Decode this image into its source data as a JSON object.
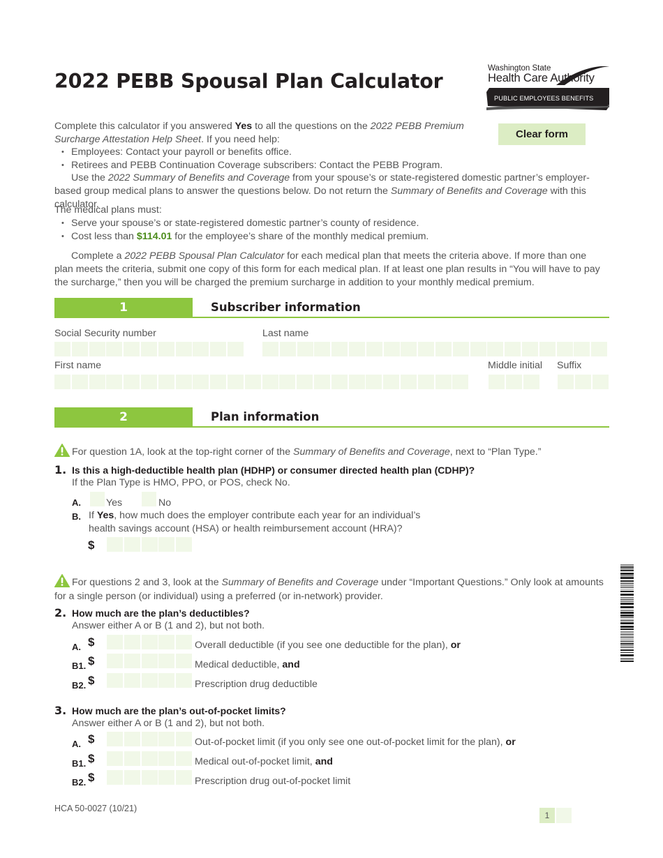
{
  "header": {
    "title": "2022 PEBB Spousal Plan Calculator",
    "logo": {
      "line1": "Washington State",
      "line2": "Health Care Authority",
      "band": "PUBLIC EMPLOYEES BENEFITS BOARD"
    },
    "clear_button": "Clear form"
  },
  "intro": {
    "p1_a": "Complete this calculator if you answered ",
    "p1_yes": "Yes",
    "p1_b": " to all the questions on the ",
    "p1_doc": "2022 PEBB Premium Surcharge Attestation Help Sheet",
    "p1_c": ". If you need help:",
    "help_items": [
      "Employees: Contact your payroll or benefits office.",
      "Retirees and PEBB Continuation Coverage subscribers: Contact the PEBB Program."
    ],
    "p2_a": "Use the ",
    "p2_doc": "2022 Summary of Benefits and Coverage",
    "p2_b": " from your spouse’s or state-registered domestic partner’s employer-based group medical plans to answer the questions below. Do not return the ",
    "p2_doc2": "Summary of Benefits and Coverage",
    "p2_c": " with this calculator.",
    "must_label": "The medical plans must:",
    "must_item1": "Serve your spouse’s or state-registered domestic partner’s county of residence.",
    "must_item2_a": "Cost less than ",
    "must_item2_amount": "$114.01",
    "must_item2_b": " for the employee’s share of the monthly medical premium.",
    "p3_a": "Complete a ",
    "p3_doc": "2022 PEBB Spousal Plan Calculator",
    "p3_b": " for each medical plan that meets the criteria above. If more than one plan meets the criteria, submit one copy of this form for each medical plan. If at least one plan results in “You will have to pay the surcharge,” then you will be charged the premium surcharge in addition to your monthly medical premium."
  },
  "section1": {
    "number": "1",
    "title": "Subscriber information",
    "fields": {
      "ssn": {
        "label": "Social Security number",
        "value": ""
      },
      "last_name": {
        "label": "Last name",
        "value": ""
      },
      "first_name": {
        "label": "First name",
        "value": ""
      },
      "middle_initial": {
        "label": "Middle initial",
        "value": ""
      },
      "suffix": {
        "label": "Suffix",
        "value": ""
      }
    }
  },
  "section2": {
    "number": "2",
    "title": "Plan information",
    "note1_a": "For question 1A, look at the top-right corner of the ",
    "note1_doc": "Summary of Benefits and Coverage",
    "note1_b": ", next to “Plan Type.”",
    "q1": {
      "number": "1.",
      "text": "Is this a high-deductible health plan (HDHP) or consumer directed health plan (CDHP)?",
      "sub": "If the Plan Type is HMO, PPO, or POS, check No.",
      "a_label": "A.",
      "yes": "Yes",
      "no": "No",
      "b_label": "B.",
      "b_text_a": "If ",
      "b_text_yes": "Yes",
      "b_text_b": ", how much does the employer contribute each year for an individual’s",
      "b_text_line2": "health savings account (HSA) or health reimbursement account (HRA)?",
      "currency": "$",
      "amount": ""
    },
    "note2_a": "For questions 2 and 3, look at the ",
    "note2_doc": "Summary of Benefits and Coverage",
    "note2_b": " under “Important Questions.” Only look at amounts for a single person (or individual) using a preferred (or in-network) provider.",
    "q2": {
      "number": "2.",
      "text": "How much are the plan’s deductibles?",
      "sub": "Answer either A or B (1 and 2), but not both.",
      "rows": [
        {
          "label": "A.",
          "currency": "$",
          "desc": "Overall deductible (if you see one deductible for the plan), ",
          "conj": "or",
          "value": ""
        },
        {
          "label": "B1.",
          "currency": "$",
          "desc": "Medical deductible, ",
          "conj": "and",
          "value": ""
        },
        {
          "label": "B2.",
          "currency": "$",
          "desc": "Prescription drug deductible",
          "conj": "",
          "value": ""
        }
      ]
    },
    "q3": {
      "number": "3.",
      "text": "How much are the plan’s out-of-pocket limits?",
      "sub": "Answer either A or B (1 and 2), but not both.",
      "rows": [
        {
          "label": "A.",
          "currency": "$",
          "desc": "Out-of-pocket limit (if you only see one out-of-pocket limit for the plan), ",
          "conj": "or",
          "value": ""
        },
        {
          "label": "B1.",
          "currency": "$",
          "desc": "Medical out-of-pocket limit, ",
          "conj": "and",
          "value": ""
        },
        {
          "label": "B2.",
          "currency": "$",
          "desc": "Prescription drug out-of-pocket limit",
          "conj": "",
          "value": ""
        }
      ]
    }
  },
  "footer": {
    "form_id": "HCA 50-0027 (10/21)",
    "page_number": "1",
    "page_total": ""
  },
  "colors": {
    "brand_green": "#8dc63f",
    "cell_fill": "#f1f8e8",
    "button_fill": "#dcedc4",
    "amount_green": "#4c8c1c"
  }
}
